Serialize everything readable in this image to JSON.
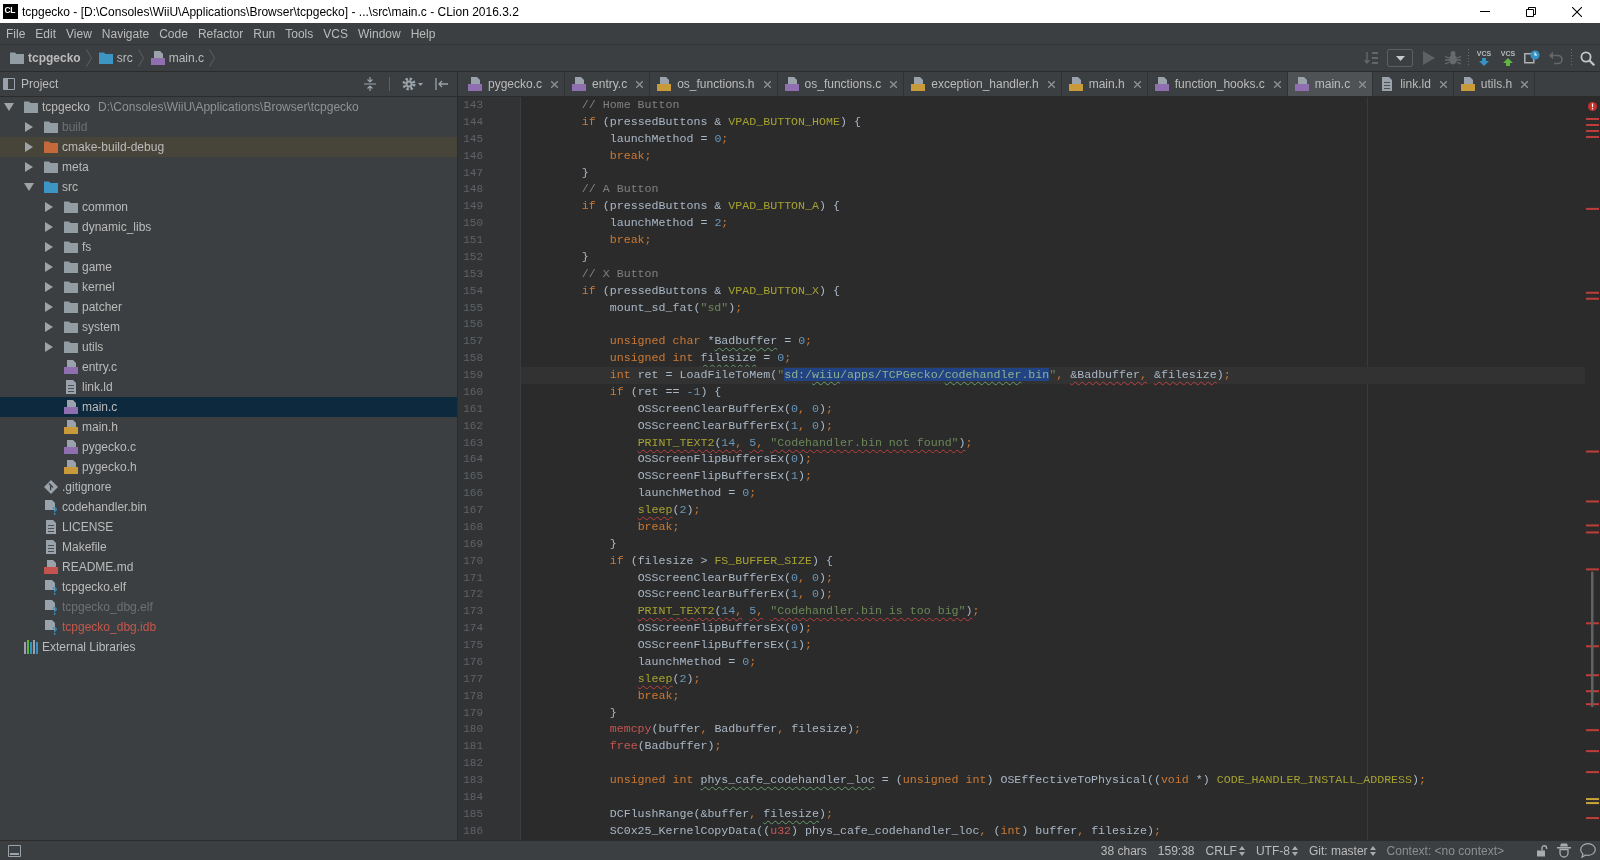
{
  "window": {
    "app_icon": "CL",
    "title": "tcpgecko - [D:\\Consoles\\WiiU\\Applications\\Browser\\tcpgecko] - ...\\src\\main.c - CLion 2016.3.2"
  },
  "menu": [
    "File",
    "Edit",
    "View",
    "Navigate",
    "Code",
    "Refactor",
    "Run",
    "Tools",
    "VCS",
    "Window",
    "Help"
  ],
  "breadcrumbs": [
    {
      "label": "tcpgecko",
      "kind": "project"
    },
    {
      "label": "src",
      "kind": "sources"
    },
    {
      "label": "main.c",
      "kind": "csource"
    }
  ],
  "toolbar": [
    {
      "kind": "build",
      "disabled": true
    },
    {
      "kind": "config",
      "disabled": false
    },
    {
      "kind": "run",
      "disabled": true
    },
    {
      "kind": "debug",
      "disabled": true
    },
    {
      "kind": "separator"
    },
    {
      "kind": "update",
      "label": "VCS",
      "disabled": false
    },
    {
      "kind": "commit",
      "label": "VCS",
      "disabled": false
    },
    {
      "kind": "history",
      "disabled": false
    },
    {
      "kind": "revert",
      "disabled": true
    },
    {
      "kind": "separator"
    },
    {
      "kind": "search",
      "disabled": false
    }
  ],
  "project_panel": {
    "title": "Project",
    "tree": [
      {
        "label": "tcpgecko",
        "detail": "D:\\Consoles\\WiiU\\Applications\\Browser\\tcpgecko",
        "kind": "folder",
        "expanded": true,
        "selected": false,
        "children": [
          {
            "label": "build",
            "kind": "folder",
            "expanded": false,
            "selected": false,
            "color": "#6d7174"
          },
          {
            "label": "cmake-build-debug",
            "kind": "excluded",
            "expanded": false,
            "selected": false
          },
          {
            "label": "meta",
            "kind": "folder",
            "expanded": false,
            "selected": false
          },
          {
            "label": "src",
            "kind": "sources",
            "expanded": true,
            "selected": false,
            "children": [
              {
                "label": "common",
                "kind": "folder",
                "expanded": false,
                "selected": false
              },
              {
                "label": "dynamic_libs",
                "kind": "folder",
                "expanded": false,
                "selected": false
              },
              {
                "label": "fs",
                "kind": "folder",
                "expanded": false,
                "selected": false
              },
              {
                "label": "game",
                "kind": "folder",
                "expanded": false,
                "selected": false
              },
              {
                "label": "kernel",
                "kind": "folder",
                "expanded": false,
                "selected": false
              },
              {
                "label": "patcher",
                "kind": "folder",
                "expanded": false,
                "selected": false
              },
              {
                "label": "system",
                "kind": "folder",
                "expanded": false,
                "selected": false
              },
              {
                "label": "utils",
                "kind": "folder",
                "expanded": false,
                "selected": false
              },
              {
                "label": "entry.c",
                "kind": "csource",
                "selected": false
              },
              {
                "label": "link.ld",
                "kind": "text",
                "selected": false
              },
              {
                "label": "main.c",
                "kind": "csource",
                "selected": true
              },
              {
                "label": "main.h",
                "kind": "header",
                "selected": false
              },
              {
                "label": "pygecko.c",
                "kind": "csource",
                "selected": false
              },
              {
                "label": "pygecko.h",
                "kind": "header",
                "selected": false
              }
            ]
          },
          {
            "label": ".gitignore",
            "kind": "gitignore",
            "selected": false
          },
          {
            "label": "codehandler.bin",
            "kind": "unknown",
            "selected": false
          },
          {
            "label": "LICENSE",
            "kind": "text",
            "selected": false
          },
          {
            "label": "Makefile",
            "kind": "text",
            "selected": false
          },
          {
            "label": "README.md",
            "kind": "markdown",
            "selected": false
          },
          {
            "label": "tcpgecko.elf",
            "kind": "unknown",
            "selected": false
          },
          {
            "label": "tcpgecko_dbg.elf",
            "kind": "unknown",
            "selected": false,
            "color": "#6d7174"
          },
          {
            "label": "tcpgecko_dbg.idb",
            "kind": "unknown",
            "selected": false,
            "color": "#c3584e"
          }
        ]
      },
      {
        "label": "External Libraries",
        "kind": "libraries",
        "selected": false
      }
    ]
  },
  "editor": {
    "tabs": [
      {
        "label": "pygecko.c",
        "kind": "csource",
        "selected": false
      },
      {
        "label": "entry.c",
        "kind": "csource",
        "selected": false
      },
      {
        "label": "os_functions.h",
        "kind": "header",
        "selected": false
      },
      {
        "label": "os_functions.c",
        "kind": "csource",
        "selected": false
      },
      {
        "label": "exception_handler.h",
        "kind": "header",
        "selected": false
      },
      {
        "label": "main.h",
        "kind": "header",
        "selected": false
      },
      {
        "label": "function_hooks.c",
        "kind": "csource",
        "selected": false
      },
      {
        "label": "main.c",
        "kind": "csource",
        "selected": true
      },
      {
        "label": "link.ld",
        "kind": "text",
        "selected": false
      },
      {
        "label": "utils.h",
        "kind": "header",
        "selected": false
      }
    ],
    "lines": [
      {
        "number": "143",
        "current": false,
        "tokens": [
          {
            "text": "        // Home Button",
            "kind": "comment"
          }
        ]
      },
      {
        "number": "144",
        "current": false,
        "tokens": [
          {
            "text": "        if",
            "kind": "keyword"
          },
          {
            "text": " (pressedButtons & ",
            "kind": "plain"
          },
          {
            "text": "VPAD_BUTTON_HOME",
            "kind": "macro"
          },
          {
            "text": ") {",
            "kind": "plain"
          }
        ]
      },
      {
        "number": "145",
        "current": false,
        "tokens": [
          {
            "text": "            launchMethod = ",
            "kind": "plain"
          },
          {
            "text": "0",
            "kind": "number"
          },
          {
            "text": ";",
            "kind": "punct"
          }
        ]
      },
      {
        "number": "146",
        "current": false,
        "tokens": [
          {
            "text": "            break",
            "kind": "keyword"
          },
          {
            "text": ";",
            "kind": "punct"
          }
        ]
      },
      {
        "number": "147",
        "current": false,
        "tokens": [
          {
            "text": "        }",
            "kind": "plain"
          }
        ]
      },
      {
        "number": "148",
        "current": false,
        "tokens": [
          {
            "text": "        // A Button",
            "kind": "comment"
          }
        ]
      },
      {
        "number": "149",
        "current": false,
        "tokens": [
          {
            "text": "        if",
            "kind": "keyword"
          },
          {
            "text": " (pressedButtons & ",
            "kind": "plain"
          },
          {
            "text": "VPAD_BUTTON_A",
            "kind": "macro"
          },
          {
            "text": ") {",
            "kind": "plain"
          }
        ]
      },
      {
        "number": "150",
        "current": false,
        "tokens": [
          {
            "text": "            launchMethod = ",
            "kind": "plain"
          },
          {
            "text": "2",
            "kind": "number"
          },
          {
            "text": ";",
            "kind": "punct"
          }
        ]
      },
      {
        "number": "151",
        "current": false,
        "tokens": [
          {
            "text": "            break",
            "kind": "keyword"
          },
          {
            "text": ";",
            "kind": "punct"
          }
        ]
      },
      {
        "number": "152",
        "current": false,
        "tokens": [
          {
            "text": "        }",
            "kind": "plain"
          }
        ]
      },
      {
        "number": "153",
        "current": false,
        "tokens": [
          {
            "text": "        // X Button",
            "kind": "comment"
          }
        ]
      },
      {
        "number": "154",
        "current": false,
        "tokens": [
          {
            "text": "        if",
            "kind": "keyword"
          },
          {
            "text": " (pressedButtons & ",
            "kind": "plain"
          },
          {
            "text": "VPAD_BUTTON_X",
            "kind": "macro"
          },
          {
            "text": ") {",
            "kind": "plain"
          }
        ]
      },
      {
        "number": "155",
        "current": false,
        "tokens": [
          {
            "text": "            mount_sd_fat(",
            "kind": "plain"
          },
          {
            "text": "\"sd\"",
            "kind": "string"
          },
          {
            "text": ")",
            "kind": "plain"
          },
          {
            "text": ";",
            "kind": "punct"
          }
        ]
      },
      {
        "number": "156",
        "current": false
      },
      {
        "number": "157",
        "current": false,
        "tokens": [
          {
            "text": "            unsigned char",
            "kind": "keyword"
          },
          {
            "text": " *",
            "kind": "plain"
          },
          {
            "text": "Badbuffer",
            "kind": "plain",
            "squiggle": {
              "kind": "typo"
            }
          },
          {
            "text": " = ",
            "kind": "plain"
          },
          {
            "text": "0",
            "kind": "number"
          },
          {
            "text": ";",
            "kind": "punct"
          }
        ]
      },
      {
        "number": "158",
        "current": false,
        "tokens": [
          {
            "text": "            unsigned int",
            "kind": "keyword"
          },
          {
            "text": " filesize",
            "kind": "plain",
            "squiggle": {
              "kind": "typo"
            }
          },
          {
            "text": " = ",
            "kind": "plain"
          },
          {
            "text": "0",
            "kind": "number"
          },
          {
            "text": ";",
            "kind": "punct"
          }
        ]
      },
      {
        "number": "159",
        "current": true,
        "tokens": [
          {
            "text": "            int",
            "kind": "keyword"
          },
          {
            "text": " ret = LoadFileToMem(",
            "kind": "plain"
          },
          {
            "text": "\"",
            "kind": "string"
          },
          {
            "text": "sd:/",
            "kind": "selection"
          },
          {
            "text": "wiiu",
            "kind": "selection",
            "squiggle": {
              "kind": "typo"
            }
          },
          {
            "text": "/apps/TCPGecko/",
            "kind": "selection"
          },
          {
            "text": "codehandler",
            "kind": "selection",
            "squiggle": {
              "kind": "typo"
            }
          },
          {
            "text": ".bin",
            "kind": "selection"
          },
          {
            "text": "\"",
            "kind": "string"
          },
          {
            "text": ",",
            "kind": "punct"
          },
          {
            "text": " &Badbuffer",
            "kind": "plain",
            "squiggle": {
              "kind": "error"
            }
          },
          {
            "text": ",",
            "kind": "punct",
            "squiggle": {
              "kind": "error"
            }
          },
          {
            "text": " &filesize",
            "kind": "plain",
            "squiggle": {
              "kind": "error"
            }
          },
          {
            "text": ")",
            "kind": "plain"
          },
          {
            "text": ";",
            "kind": "punct"
          }
        ]
      },
      {
        "number": "160",
        "current": false,
        "tokens": [
          {
            "text": "            if",
            "kind": "keyword"
          },
          {
            "text": " (ret == ",
            "kind": "plain"
          },
          {
            "text": "-1",
            "kind": "number"
          },
          {
            "text": ") {",
            "kind": "plain"
          }
        ]
      },
      {
        "number": "161",
        "current": false,
        "tokens": [
          {
            "text": "                OSScreenClearBufferEx(",
            "kind": "plain"
          },
          {
            "text": "0",
            "kind": "number"
          },
          {
            "text": ",",
            "kind": "punct"
          },
          {
            "text": " 0",
            "kind": "number"
          },
          {
            "text": ")",
            "kind": "plain"
          },
          {
            "text": ";",
            "kind": "punct"
          }
        ]
      },
      {
        "number": "162",
        "current": false,
        "tokens": [
          {
            "text": "                OSScreenClearBufferEx(",
            "kind": "plain"
          },
          {
            "text": "1",
            "kind": "number"
          },
          {
            "text": ",",
            "kind": "punct"
          },
          {
            "text": " 0",
            "kind": "number"
          },
          {
            "text": ")",
            "kind": "plain"
          },
          {
            "text": ";",
            "kind": "punct"
          }
        ]
      },
      {
        "number": "163",
        "current": false,
        "tokens": [
          {
            "text": "                PRINT_TEXT2",
            "kind": "macro",
            "squiggle": {
              "kind": "error"
            }
          },
          {
            "text": "(",
            "kind": "plain",
            "squiggle": {
              "kind": "error"
            }
          },
          {
            "text": "14",
            "kind": "number",
            "squiggle": {
              "kind": "error"
            }
          },
          {
            "text": ",",
            "kind": "punct",
            "squiggle": {
              "kind": "error"
            }
          },
          {
            "text": " 5",
            "kind": "number",
            "squiggle": {
              "kind": "error"
            }
          },
          {
            "text": ",",
            "kind": "punct",
            "squiggle": {
              "kind": "error"
            }
          },
          {
            "text": " \"Codehandler.bin not found\"",
            "kind": "string",
            "squiggle": {
              "kind": "error"
            }
          },
          {
            "text": ")",
            "kind": "plain",
            "squiggle": {
              "kind": "error"
            }
          },
          {
            "text": ";",
            "kind": "punct"
          }
        ]
      },
      {
        "number": "164",
        "current": false,
        "tokens": [
          {
            "text": "                OSScreenFlipBuffersEx(",
            "kind": "plain"
          },
          {
            "text": "0",
            "kind": "number"
          },
          {
            "text": ")",
            "kind": "plain"
          },
          {
            "text": ";",
            "kind": "punct"
          }
        ]
      },
      {
        "number": "165",
        "current": false,
        "tokens": [
          {
            "text": "                OSScreenFlipBuffersEx(",
            "kind": "plain"
          },
          {
            "text": "1",
            "kind": "number"
          },
          {
            "text": ")",
            "kind": "plain"
          },
          {
            "text": ";",
            "kind": "punct"
          }
        ]
      },
      {
        "number": "166",
        "current": false,
        "tokens": [
          {
            "text": "                launchMethod = ",
            "kind": "plain"
          },
          {
            "text": "0",
            "kind": "number"
          },
          {
            "text": ";",
            "kind": "punct"
          }
        ]
      },
      {
        "number": "167",
        "current": false,
        "tokens": [
          {
            "text": "                sleep",
            "kind": "macro",
            "squiggle": {
              "kind": "error"
            }
          },
          {
            "text": "(",
            "kind": "plain"
          },
          {
            "text": "2",
            "kind": "number"
          },
          {
            "text": ")",
            "kind": "plain"
          },
          {
            "text": ";",
            "kind": "punct"
          }
        ]
      },
      {
        "number": "168",
        "current": false,
        "tokens": [
          {
            "text": "                break",
            "kind": "keyword"
          },
          {
            "text": ";",
            "kind": "punct"
          }
        ]
      },
      {
        "number": "169",
        "current": false,
        "tokens": [
          {
            "text": "            }",
            "kind": "plain"
          }
        ]
      },
      {
        "number": "170",
        "current": false,
        "tokens": [
          {
            "text": "            if",
            "kind": "keyword"
          },
          {
            "text": " (filesize > ",
            "kind": "plain"
          },
          {
            "text": "FS_BUFFER_SIZE",
            "kind": "macro"
          },
          {
            "text": ") {",
            "kind": "plain"
          }
        ]
      },
      {
        "number": "171",
        "current": false,
        "tokens": [
          {
            "text": "                OSScreenClearBufferEx(",
            "kind": "plain"
          },
          {
            "text": "0",
            "kind": "number"
          },
          {
            "text": ",",
            "kind": "punct"
          },
          {
            "text": " 0",
            "kind": "number"
          },
          {
            "text": ")",
            "kind": "plain"
          },
          {
            "text": ";",
            "kind": "punct"
          }
        ]
      },
      {
        "number": "172",
        "current": false,
        "tokens": [
          {
            "text": "                OSScreenClearBufferEx(",
            "kind": "plain"
          },
          {
            "text": "1",
            "kind": "number"
          },
          {
            "text": ",",
            "kind": "punct"
          },
          {
            "text": " 0",
            "kind": "number"
          },
          {
            "text": ")",
            "kind": "plain"
          },
          {
            "text": ";",
            "kind": "punct"
          }
        ]
      },
      {
        "number": "173",
        "current": false,
        "tokens": [
          {
            "text": "                PRINT_TEXT2",
            "kind": "macro",
            "squiggle": {
              "kind": "error"
            }
          },
          {
            "text": "(",
            "kind": "plain",
            "squiggle": {
              "kind": "error"
            }
          },
          {
            "text": "14",
            "kind": "number",
            "squiggle": {
              "kind": "error"
            }
          },
          {
            "text": ",",
            "kind": "punct",
            "squiggle": {
              "kind": "error"
            }
          },
          {
            "text": " 5",
            "kind": "number",
            "squiggle": {
              "kind": "error"
            }
          },
          {
            "text": ",",
            "kind": "punct",
            "squiggle": {
              "kind": "error"
            }
          },
          {
            "text": " \"Codehandler.bin is too big\"",
            "kind": "string",
            "squiggle": {
              "kind": "error"
            }
          },
          {
            "text": ")",
            "kind": "plain",
            "squiggle": {
              "kind": "error"
            }
          },
          {
            "text": ";",
            "kind": "punct"
          }
        ]
      },
      {
        "number": "174",
        "current": false,
        "tokens": [
          {
            "text": "                OSScreenFlipBuffersEx(",
            "kind": "plain"
          },
          {
            "text": "0",
            "kind": "number"
          },
          {
            "text": ")",
            "kind": "plain"
          },
          {
            "text": ";",
            "kind": "punct"
          }
        ]
      },
      {
        "number": "175",
        "current": false,
        "tokens": [
          {
            "text": "                OSScreenFlipBuffersEx(",
            "kind": "plain"
          },
          {
            "text": "1",
            "kind": "number"
          },
          {
            "text": ")",
            "kind": "plain"
          },
          {
            "text": ";",
            "kind": "punct"
          }
        ]
      },
      {
        "number": "176",
        "current": false,
        "tokens": [
          {
            "text": "                launchMethod = ",
            "kind": "plain"
          },
          {
            "text": "0",
            "kind": "number"
          },
          {
            "text": ";",
            "kind": "punct"
          }
        ]
      },
      {
        "number": "177",
        "current": false,
        "tokens": [
          {
            "text": "                sleep",
            "kind": "macro",
            "squiggle": {
              "kind": "error"
            }
          },
          {
            "text": "(",
            "kind": "plain"
          },
          {
            "text": "2",
            "kind": "number"
          },
          {
            "text": ")",
            "kind": "plain"
          },
          {
            "text": ";",
            "kind": "punct"
          }
        ]
      },
      {
        "number": "178",
        "current": false,
        "tokens": [
          {
            "text": "                break",
            "kind": "keyword"
          },
          {
            "text": ";",
            "kind": "punct"
          }
        ]
      },
      {
        "number": "179",
        "current": false,
        "tokens": [
          {
            "text": "            }",
            "kind": "plain"
          }
        ]
      },
      {
        "number": "180",
        "current": false,
        "tokens": [
          {
            "text": "            memcpy",
            "kind": "unresolved"
          },
          {
            "text": "(buffer",
            "kind": "plain"
          },
          {
            "text": ",",
            "kind": "punct"
          },
          {
            "text": " Badbuffer",
            "kind": "plain"
          },
          {
            "text": ",",
            "kind": "punct"
          },
          {
            "text": " filesize)",
            "kind": "plain"
          },
          {
            "text": ";",
            "kind": "punct"
          }
        ]
      },
      {
        "number": "181",
        "current": false,
        "tokens": [
          {
            "text": "            free",
            "kind": "unresolved"
          },
          {
            "text": "(Badbuffer)",
            "kind": "plain"
          },
          {
            "text": ";",
            "kind": "punct"
          }
        ]
      },
      {
        "number": "182",
        "current": false
      },
      {
        "number": "183",
        "current": false,
        "tokens": [
          {
            "text": "            unsigned int",
            "kind": "keyword"
          },
          {
            "text": " phys_cafe_codehandler_loc",
            "kind": "plain",
            "squiggle": {
              "kind": "typo"
            }
          },
          {
            "text": " = (",
            "kind": "plain"
          },
          {
            "text": "unsigned int",
            "kind": "keyword"
          },
          {
            "text": ") OSEffectiveToPhysical((",
            "kind": "plain"
          },
          {
            "text": "void",
            "kind": "keyword"
          },
          {
            "text": " *) ",
            "kind": "plain"
          },
          {
            "text": "CODE_HANDLER_INSTALL_ADDRESS",
            "kind": "macro"
          },
          {
            "text": ")",
            "kind": "plain"
          },
          {
            "text": ";",
            "kind": "punct"
          }
        ]
      },
      {
        "number": "184",
        "current": false
      },
      {
        "number": "185",
        "current": false,
        "tokens": [
          {
            "text": "            DCFlushRange(&buffer",
            "kind": "plain"
          },
          {
            "text": ",",
            "kind": "punct"
          },
          {
            "text": " filesize",
            "kind": "plain",
            "squiggle": {
              "kind": "typo"
            }
          },
          {
            "text": ")",
            "kind": "plain"
          },
          {
            "text": ";",
            "kind": "punct"
          }
        ]
      },
      {
        "number": "186",
        "current": false,
        "tokens": [
          {
            "text": "            SC0x25_KernelCopyData((",
            "kind": "plain"
          },
          {
            "text": "u32",
            "kind": "unresolved"
          },
          {
            "text": ") phys_cafe_codehandler_loc",
            "kind": "plain"
          },
          {
            "text": ",",
            "kind": "punct"
          },
          {
            "text": " (",
            "kind": "plain"
          },
          {
            "text": "int",
            "kind": "keyword"
          },
          {
            "text": ") buffer",
            "kind": "plain"
          },
          {
            "text": ",",
            "kind": "punct"
          },
          {
            "text": " filesize)",
            "kind": "plain"
          },
          {
            "text": ";",
            "kind": "punct"
          }
        ]
      }
    ]
  },
  "status_bar": {
    "items": [
      {
        "label": "38 chars",
        "kind": "text",
        "disabled": false
      },
      {
        "label": "159:38",
        "kind": "text",
        "disabled": false
      },
      {
        "label": "CRLF",
        "kind": "switcher",
        "disabled": false
      },
      {
        "label": "UTF-8",
        "kind": "switcher",
        "disabled": false
      },
      {
        "label": "Git: master",
        "kind": "switcher",
        "disabled": false
      },
      {
        "label": "Context: <no context>",
        "kind": "text",
        "disabled": true
      }
    ]
  }
}
